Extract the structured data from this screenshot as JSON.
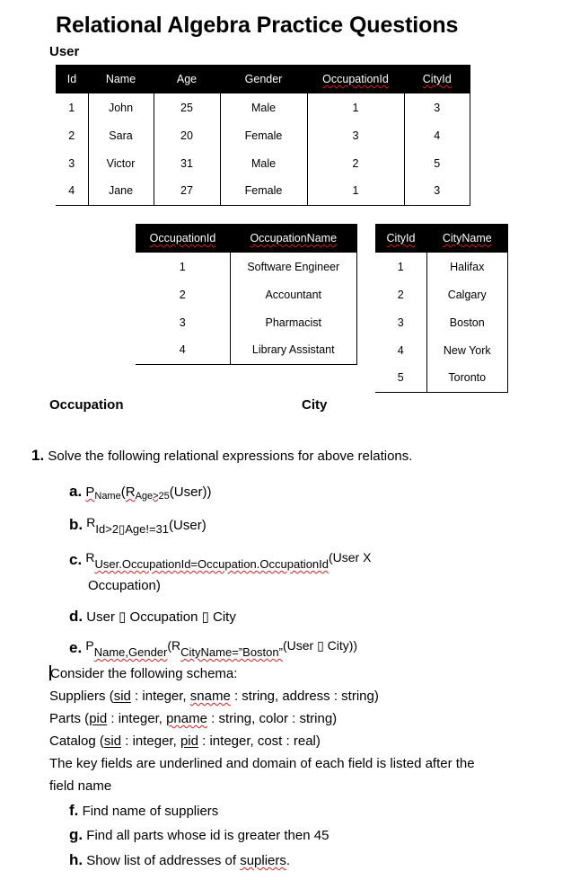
{
  "document": {
    "title": "Relational Algebra Practice Questions"
  },
  "tables": {
    "user": {
      "label": "User",
      "columns": [
        "Id",
        "Name",
        "Age",
        "Gender",
        "OccupationId",
        "CityId"
      ],
      "rows": [
        [
          "1",
          "John",
          "25",
          "Male",
          "1",
          "3"
        ],
        [
          "2",
          "Sara",
          "20",
          "Female",
          "3",
          "4"
        ],
        [
          "3",
          "Victor",
          "31",
          "Male",
          "2",
          "5"
        ],
        [
          "4",
          "Jane",
          "27",
          "Female",
          "1",
          "3"
        ]
      ]
    },
    "occupation": {
      "label": "Occupation",
      "columns": [
        "OccupationId",
        "OccupationName"
      ],
      "rows": [
        [
          "1",
          "Software Engineer"
        ],
        [
          "2",
          "Accountant"
        ],
        [
          "3",
          "Pharmacist"
        ],
        [
          "4",
          "Library Assistant"
        ]
      ]
    },
    "city": {
      "label": "City",
      "columns": [
        "CityId",
        "CityName"
      ],
      "rows": [
        [
          "1",
          "Halifax"
        ],
        [
          "2",
          "Calgary"
        ],
        [
          "3",
          "Boston"
        ],
        [
          "4",
          "New York"
        ],
        [
          "5",
          "Toronto"
        ]
      ]
    }
  },
  "question1": {
    "number": "1.",
    "text": "Solve the following relational expressions for above  relations.",
    "parts": {
      "a": {
        "label": "a.",
        "op1": "P",
        "sub1": "Name",
        "open1": "(",
        "op2": "R",
        "sub2": "Age>25",
        "rest": "(User))"
      },
      "b": {
        "label": "b.",
        "op1": "R",
        "sub1": "Id>2▯Age!=31",
        "rest": "(User)"
      },
      "c": {
        "label": "c.",
        "op1": "R",
        "sub1": "User.OccupationId=Occupation.OccupationId",
        "rest": "(User X",
        "cont": "Occupation)"
      },
      "d": {
        "label": "d.",
        "text": "User ▯ Occupation ▯ City"
      },
      "e": {
        "label": "e.",
        "op1": "P",
        "sub1": "Name,Gender",
        "open1": "(",
        "op2": "R",
        "sub2": "CityName=”Boston”",
        "rest": "(User ▯ City))"
      }
    }
  },
  "schema": {
    "intro": "Consider the following schema:",
    "relations": [
      {
        "name": "Suppliers (",
        "key": "sid",
        "rest1": " : integer, ",
        "f2": "sname",
        "rest2": " : string, address : string)"
      },
      {
        "name": "Parts (",
        "key": "pid",
        "rest1": " : integer, ",
        "f2": "pname",
        "rest2": " : string, color : string)"
      },
      {
        "name": "Catalog (",
        "key": "sid",
        "rest1": " : integer, ",
        "f2": "pid",
        "rest2": " : integer, cost : real)"
      }
    ],
    "note_line1": "The key fields are underlined and domain of each field is listed after the",
    "note_line2": "field name"
  },
  "tasks": [
    {
      "label": "f.",
      "text": "Find name of suppliers"
    },
    {
      "label": "g.",
      "text": "Find all parts whose id is greater then 45"
    },
    {
      "label": "h.",
      "text_pre": "Show list of addresses of ",
      "text_squig": "supliers",
      "text_post": "."
    }
  ]
}
